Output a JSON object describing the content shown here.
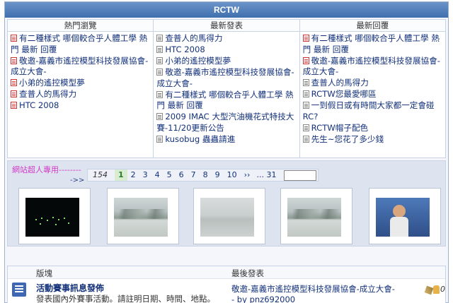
{
  "header": {
    "title": "RCTW"
  },
  "columns": [
    {
      "title": "熱門瀏覽",
      "items": [
        "有二種樣式 哪個較合乎人體工學 熱門 最新 回覆",
        "敬邀-嘉義市遙控模型科技發展協會-成立大會-",
        "小弟的遙控模型夢",
        "查普人的馬得力",
        "HTC 2008"
      ]
    },
    {
      "title": "最新發表",
      "items": [
        "查普人的馬得力",
        "HTC 2008",
        "小弟的遙控模型夢",
        "敬邀-嘉義市遙控模型科技發展協會-成立大會-",
        "有二種樣式 哪個較合乎人體工學 熱門 最新 回覆",
        "2009 IMAC 大型汽油機花式特技大賽-11/20更新公告",
        "kusobug 蟲蟲請進"
      ]
    },
    {
      "title": "最新回覆",
      "items": [
        "有二種樣式 哪個較合乎人體工學 熱門 最新 回覆",
        "敬邀-嘉義市遙控模型科技發展協會-成立大會-",
        "查普人的馬得力",
        "RCTW您最愛哪區",
        "一到假日或有時間大家都一定會碰RC?",
        "RCTW帽子配色",
        "先生~您花了多少錢"
      ]
    }
  ],
  "gallery": {
    "vip_label": "網站超人專用--------",
    "arrow_label": "->>",
    "pagination": {
      "count": "154",
      "current": "1",
      "pages": [
        "2",
        "3",
        "4",
        "5",
        "6",
        "7",
        "8",
        "9",
        "10"
      ],
      "next": "››",
      "last": "... 31",
      "jump_value": ""
    },
    "thumbnails": [
      "night-scene",
      "misty-lake",
      "foggy-lake",
      "misty-lake",
      "child-photo"
    ]
  },
  "forum": {
    "header": {
      "board": "版塊",
      "last_post": "最後發表"
    },
    "rows": [
      {
        "title": "活動賽事訊息發佈",
        "description": "發表國內外賽事活動。請註明日期、時間、地點。",
        "last_post_title": "敬邀-嘉義市遙控模型科技發展協會-成立大會-",
        "last_post_by": "- by pnz692000",
        "replies": "0"
      }
    ]
  }
}
